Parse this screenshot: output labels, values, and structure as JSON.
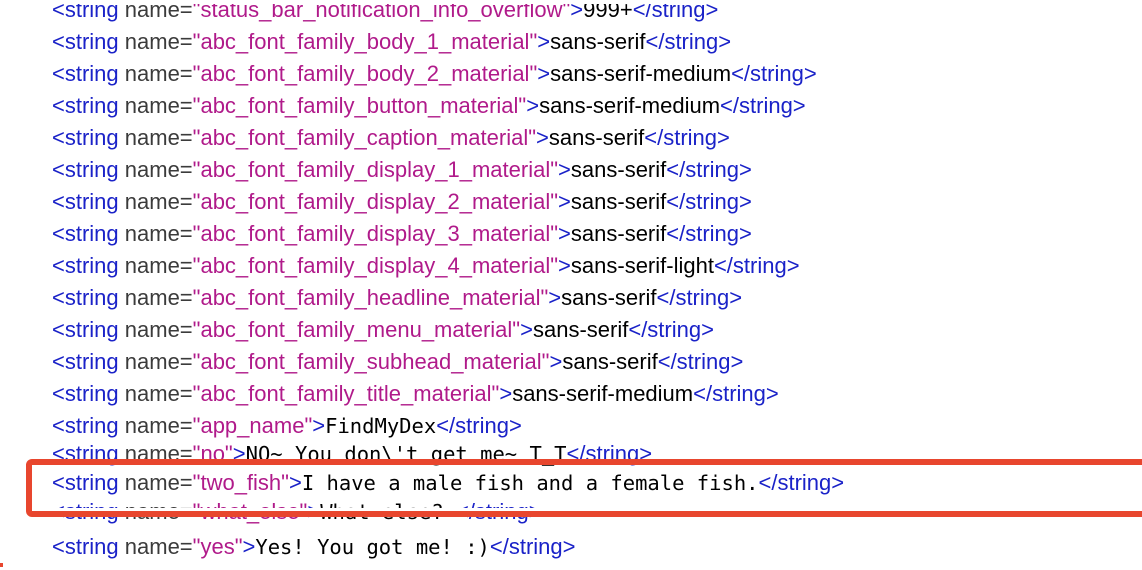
{
  "lines": [
    {
      "name": "status_bar_notification_info_overflow",
      "value": "999+"
    },
    {
      "name": "abc_font_family_body_1_material",
      "value": "sans-serif"
    },
    {
      "name": "abc_font_family_body_2_material",
      "value": "sans-serif-medium"
    },
    {
      "name": "abc_font_family_button_material",
      "value": "sans-serif-medium"
    },
    {
      "name": "abc_font_family_caption_material",
      "value": "sans-serif"
    },
    {
      "name": "abc_font_family_display_1_material",
      "value": "sans-serif"
    },
    {
      "name": "abc_font_family_display_2_material",
      "value": "sans-serif"
    },
    {
      "name": "abc_font_family_display_3_material",
      "value": "sans-serif"
    },
    {
      "name": "abc_font_family_display_4_material",
      "value": "sans-serif-light"
    },
    {
      "name": "abc_font_family_headline_material",
      "value": "sans-serif"
    },
    {
      "name": "abc_font_family_menu_material",
      "value": "sans-serif"
    },
    {
      "name": "abc_font_family_subhead_material",
      "value": "sans-serif"
    },
    {
      "name": "abc_font_family_title_material",
      "value": "sans-serif-medium"
    },
    {
      "name": "app_name",
      "value": "FindMyDex"
    },
    {
      "name": "no",
      "value": "NO~ You don\\'t get me~ T_T"
    },
    {
      "name": "two_fish",
      "value": "I have a male fish and a female fish."
    },
    {
      "name": "what_else",
      "value": "What else? "
    },
    {
      "name": "yes",
      "value": "Yes! You got me! :)"
    }
  ],
  "syntax": {
    "open_tag": "<string",
    "attr_name": "name=",
    "close_tag": "</string>",
    "gt": ">"
  },
  "colors": {
    "tag": "#1a22c8",
    "attribute_value": "#b01a8a",
    "highlight_border": "#e8462e"
  }
}
